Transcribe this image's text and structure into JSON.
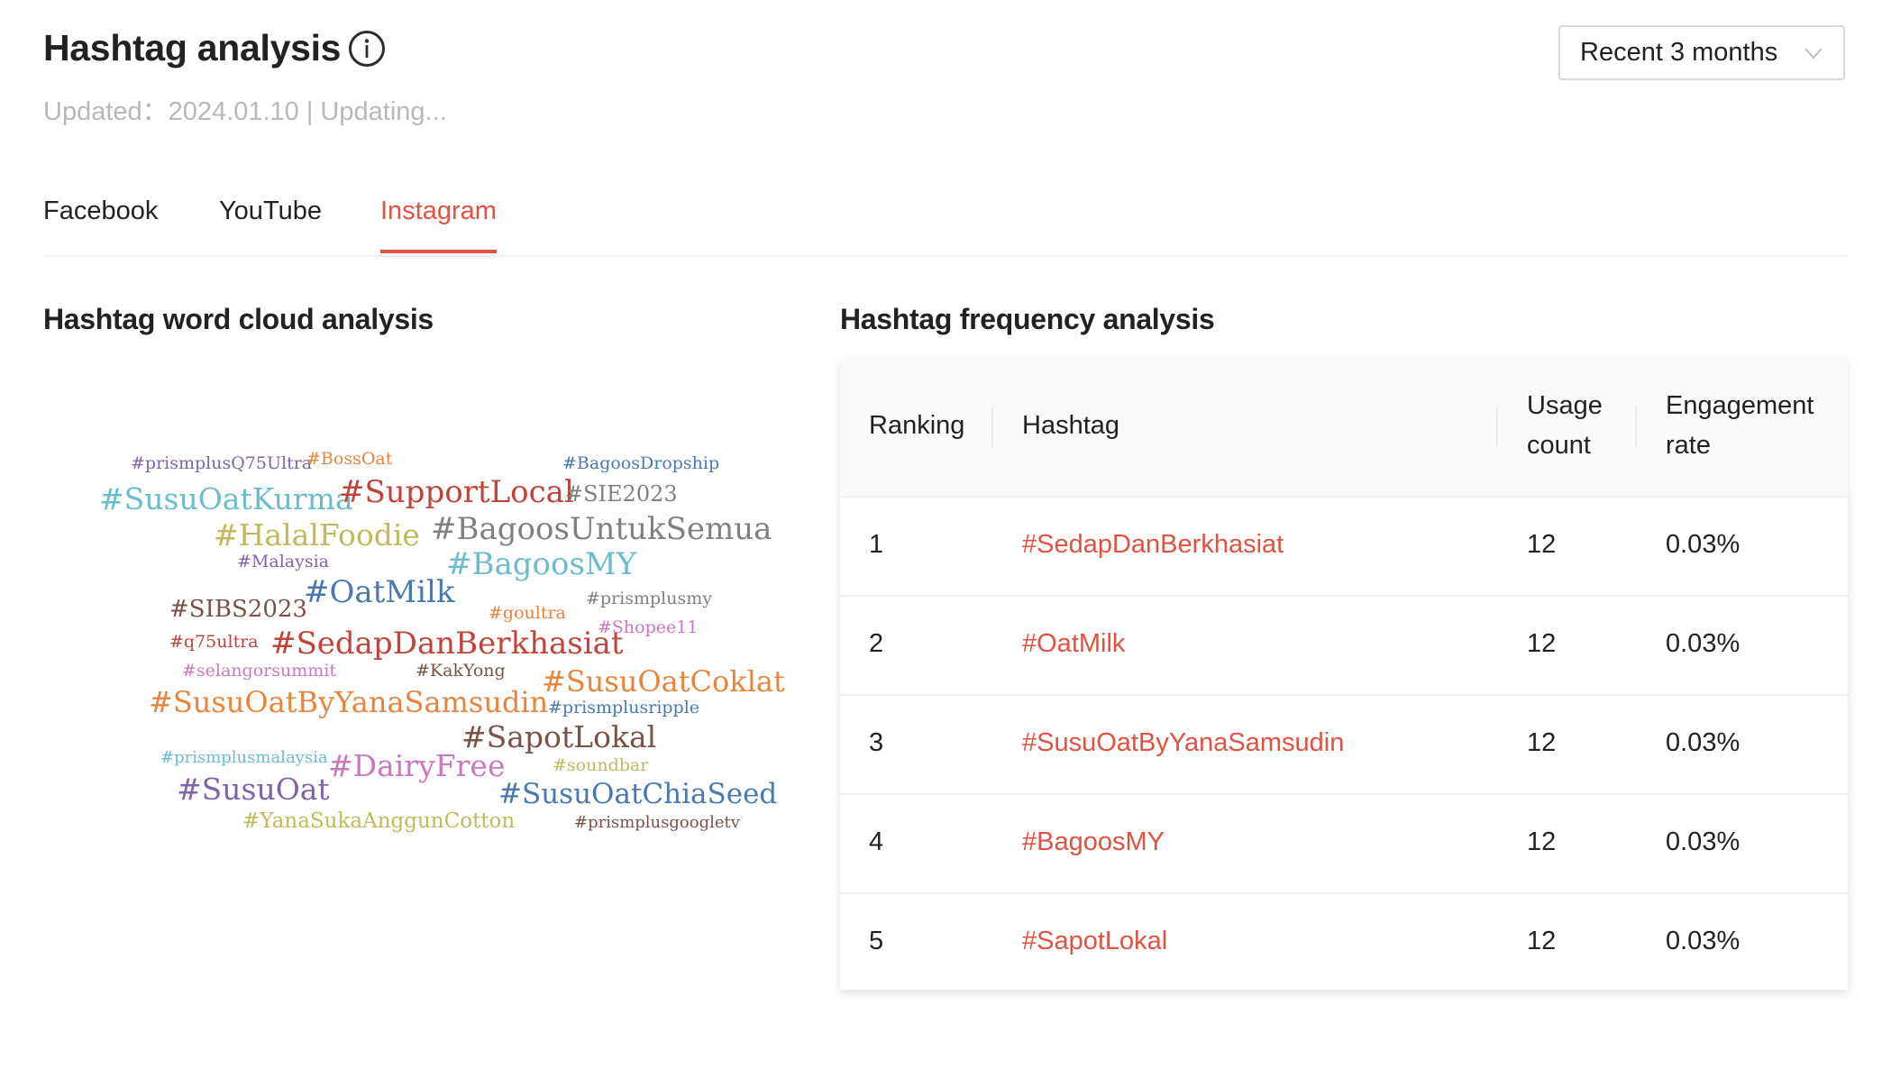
{
  "header": {
    "title": "Hashtag analysis",
    "info_icon": "info-circle-icon",
    "subtitle": "Updated：2024.01.10 | Updating...",
    "period_select": {
      "value": "Recent 3 months",
      "icon": "chevron-down-icon"
    }
  },
  "tabs": [
    {
      "label": "Facebook",
      "active": false
    },
    {
      "label": "YouTube",
      "active": false
    },
    {
      "label": "Instagram",
      "active": true
    }
  ],
  "accent_color": "#e05241",
  "word_cloud": {
    "title": "Hashtag word cloud analysis",
    "words": [
      {
        "text": "#prismplusQ75Ultra",
        "color": "#8064a8"
      },
      {
        "text": "#BossOat",
        "color": "#e8843c"
      },
      {
        "text": "#BagoosDropship",
        "color": "#4a78b0"
      },
      {
        "text": "#SusuOatKurma",
        "color": "#6bbccc"
      },
      {
        "text": "#SupportLocal",
        "color": "#c0443a"
      },
      {
        "text": "#SIE2023",
        "color": "#808080"
      },
      {
        "text": "#HalalFoodie",
        "color": "#bfba5a"
      },
      {
        "text": "#BagoosUntukSemua",
        "color": "#808080"
      },
      {
        "text": "#Malaysia",
        "color": "#8064a8"
      },
      {
        "text": "#BagoosMY",
        "color": "#6bbccc"
      },
      {
        "text": "#OatMilk",
        "color": "#4a78b0"
      },
      {
        "text": "#SIBS2023",
        "color": "#7a5248"
      },
      {
        "text": "#goultra",
        "color": "#e8843c"
      },
      {
        "text": "#prismplusmy",
        "color": "#808080"
      },
      {
        "text": "#Shopee11",
        "color": "#cc78bc"
      },
      {
        "text": "#q75ultra",
        "color": "#c0443a"
      },
      {
        "text": "#SedapDanBerkhasiat",
        "color": "#c0443a"
      },
      {
        "text": "#selangorsummit",
        "color": "#cc78bc"
      },
      {
        "text": "#KakYong",
        "color": "#7a5248"
      },
      {
        "text": "#SusuOatCoklat",
        "color": "#e8843c"
      },
      {
        "text": "#SusuOatByYanaSamsudin",
        "color": "#e8843c"
      },
      {
        "text": "#prismplusripple",
        "color": "#4a78b0"
      },
      {
        "text": "#SapotLokal",
        "color": "#7a5248"
      },
      {
        "text": "#prismplusmalaysia",
        "color": "#6bbccc"
      },
      {
        "text": "#DairyFree",
        "color": "#cc78bc"
      },
      {
        "text": "#soundbar",
        "color": "#bfba5a"
      },
      {
        "text": "#SusuOat",
        "color": "#8064a8"
      },
      {
        "text": "#SusuOatChiaSeed",
        "color": "#4a78b0"
      },
      {
        "text": "#YanaSukaAnggunCotton",
        "color": "#bfba5a"
      },
      {
        "text": "#prismplusgoogletv",
        "color": "#7a5248"
      }
    ]
  },
  "frequency_table": {
    "title": "Hashtag frequency analysis",
    "columns": [
      "Ranking",
      "Hashtag",
      "Usage count",
      "Engagement rate"
    ],
    "rows": [
      {
        "rank": "1",
        "hashtag": "#SedapDanBerkhasiat",
        "usage": "12",
        "engagement": "0.03%"
      },
      {
        "rank": "2",
        "hashtag": "#OatMilk",
        "usage": "12",
        "engagement": "0.03%"
      },
      {
        "rank": "3",
        "hashtag": "#SusuOatByYanaSamsudin",
        "usage": "12",
        "engagement": "0.03%"
      },
      {
        "rank": "4",
        "hashtag": "#BagoosMY",
        "usage": "12",
        "engagement": "0.03%"
      },
      {
        "rank": "5",
        "hashtag": "#SapotLokal",
        "usage": "12",
        "engagement": "0.03%"
      }
    ]
  }
}
